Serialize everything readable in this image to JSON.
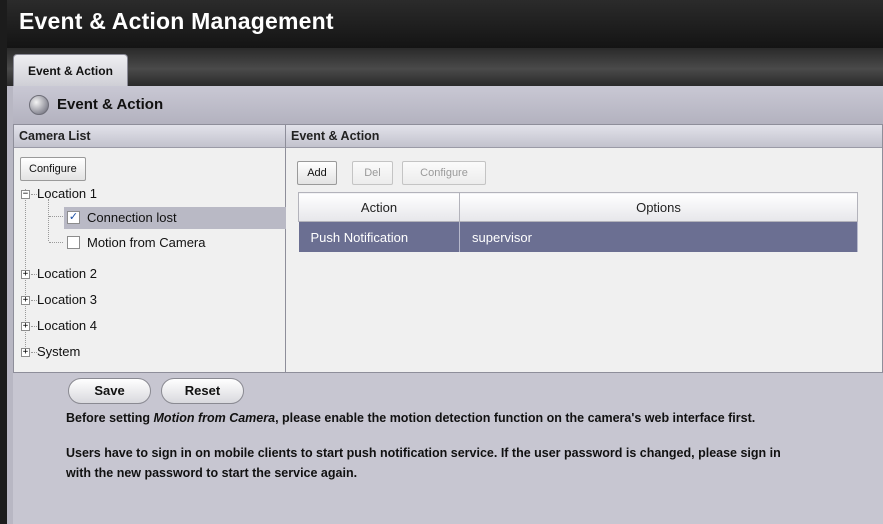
{
  "app_title": "Event & Action Management",
  "tabs": [
    {
      "label": "Event & Action"
    }
  ],
  "section_title": "Event & Action",
  "camera_list": {
    "header": "Camera List",
    "configure_label": "Configure",
    "tree": {
      "location1": "Location 1",
      "connection_lost": "Connection lost",
      "motion_from_camera": "Motion from Camera",
      "location2": "Location 2",
      "location3": "Location 3",
      "location4": "Location 4",
      "system": "System"
    },
    "connection_lost_checked": true,
    "motion_from_camera_checked": false
  },
  "event_action": {
    "header": "Event & Action",
    "add_label": "Add",
    "del_label": "Del",
    "configure_label": "Configure",
    "columns": [
      "Action",
      "Options"
    ],
    "rows": [
      {
        "action": "Push Notification",
        "options": "supervisor"
      }
    ]
  },
  "footer": {
    "save_label": "Save",
    "reset_label": "Reset",
    "note1_prefix": "Before setting ",
    "note1_emph": "Motion from Camera",
    "note1_suffix": ", please enable the motion detection function on the camera's web interface first.",
    "note2_line1": "Users have to sign in on mobile clients to start push notification service. If the user password is changed, please sign in",
    "note2_line2": "with the new password to start the service again."
  }
}
